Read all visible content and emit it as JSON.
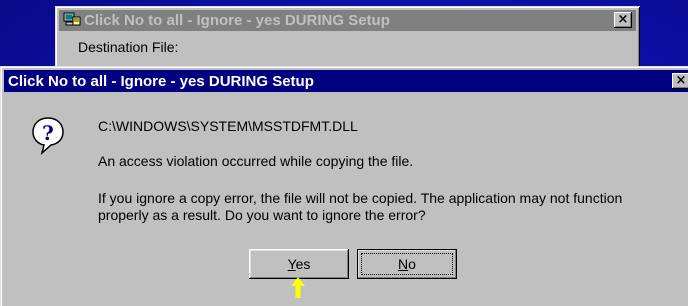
{
  "background_window": {
    "title": "Click No to all - Ignore - yes DURING Setup",
    "field_label": "Destination File:",
    "close_glyph": "×"
  },
  "dialog": {
    "title": "Click No to all - Ignore - yes DURING Setup",
    "close_glyph": "×",
    "icon": "question-icon",
    "file_path": "C:\\WINDOWS\\SYSTEM\\MSSTDFMT.DLL",
    "violation_message": "An access violation occurred while copying the file.",
    "prompt_line1": "If you ignore a copy error, the file will not be copied.  The application may not function",
    "prompt_line2": "properly as a result.  Do you want to ignore the error?",
    "buttons": {
      "yes": {
        "label": "Yes",
        "mnemonic": "Y",
        "rest": "es"
      },
      "no": {
        "label": "No",
        "mnemonic": "N",
        "rest": "o"
      }
    }
  },
  "colors": {
    "desktop": "#0c10a8",
    "active_titlebar": "#000080",
    "inactive_titlebar": "#808080",
    "face": "#c0c0c0",
    "pointer_arrow": "#ffff00"
  }
}
